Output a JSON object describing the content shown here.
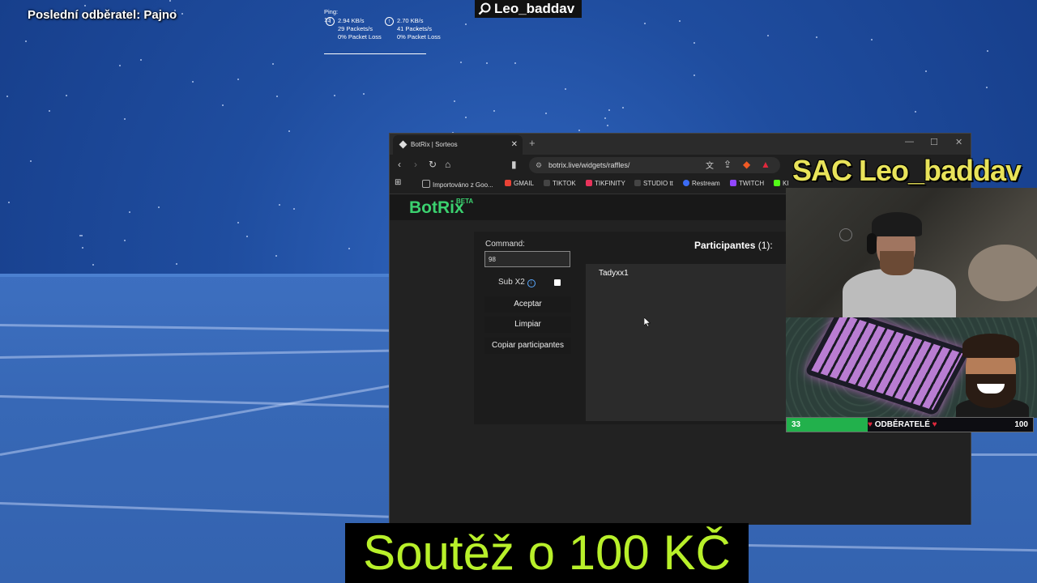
{
  "overlay": {
    "last_subscriber": "Poslední odběratel: Pajno",
    "channel_tag": "Leo_baddav",
    "caption": "Soutěž o 100 KČ",
    "cam_title": "SAC Leo_baddav"
  },
  "network": {
    "ping": "Ping: 13",
    "down_rate": "2.94 KB/s",
    "down_packets": "29 Packets/s",
    "down_loss": "0% Packet Loss",
    "up_rate": "2.70 KB/s",
    "up_packets": "41 Packets/s",
    "up_loss": "0% Packet Loss"
  },
  "browser": {
    "tab_title": "BotRix | Sorteos",
    "url": "botrix.live/widgets/raffles/",
    "bookmarks": [
      {
        "label": "Importováno z Goo...",
        "color": "#aaaaaa"
      },
      {
        "label": "GMAIL",
        "color": "#e94235"
      },
      {
        "label": "TIKTOK",
        "color": "#222222"
      },
      {
        "label": "TIKFINITY",
        "color": "#e8335b"
      },
      {
        "label": "STUDIO tt",
        "color": "#222222"
      },
      {
        "label": "Restream",
        "color": "#3b6cf5"
      },
      {
        "label": "TWITCH",
        "color": "#9146ff"
      },
      {
        "label": "KI",
        "color": "#53fc18"
      }
    ]
  },
  "botrix": {
    "logo": "BotRix",
    "beta": "BETA",
    "command_label": "Command:",
    "command_value": "98",
    "sub_x2_label": "Sub X2",
    "accept_button": "Aceptar",
    "clear_button": "Limpiar",
    "copy_button": "Copiar participantes",
    "participants_label": "Participantes",
    "participants_count": "(1):",
    "participants": [
      "Tadyxx1"
    ]
  },
  "subgoal": {
    "current": "33",
    "label": "ODBĚRATELÉ",
    "target": "100",
    "progress": 0.33,
    "bar_color": "#22b14c"
  }
}
